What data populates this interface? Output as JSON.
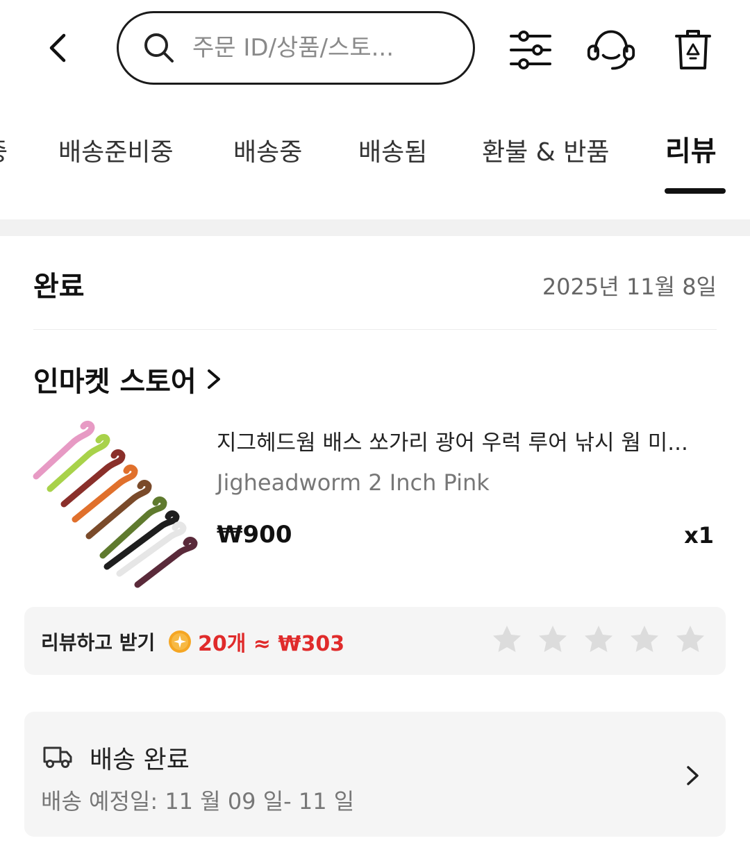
{
  "search": {
    "placeholder": "주문 ID/상품/스토..."
  },
  "header_icons": {
    "back": "back-arrow-icon",
    "filter": "filter-sliders-icon",
    "support": "headset-icon",
    "trash": "trash-icon"
  },
  "tabs": [
    {
      "label": "중",
      "active": false
    },
    {
      "label": "배송준비중",
      "active": false
    },
    {
      "label": "배송중",
      "active": false
    },
    {
      "label": "배송됨",
      "active": false
    },
    {
      "label": "환불 & 반품",
      "active": false
    },
    {
      "label": "리뷰",
      "active": true
    }
  ],
  "order": {
    "status": "완료",
    "date": "2025년 11월 8일",
    "store": "인마켓 스토어",
    "product": {
      "title": "지그헤드웜 배스 쏘가리 광어 우럭 루어 낚시 웜 미...",
      "variant": "Jigheadworm 2 Inch Pink",
      "price": "₩900",
      "qty": "x1"
    }
  },
  "review": {
    "label": "리뷰하고 받기",
    "reward": "20개 ≈ ₩303",
    "rating": 0,
    "max_rating": 5
  },
  "delivery": {
    "title": "배송 완료",
    "subtitle": "배송 예정일: 11 월 09 일- 11 일"
  },
  "colors": {
    "accent_red": "#e02b2b",
    "coin_orange": "#f5a623",
    "star_gray": "#dcdcdc"
  }
}
